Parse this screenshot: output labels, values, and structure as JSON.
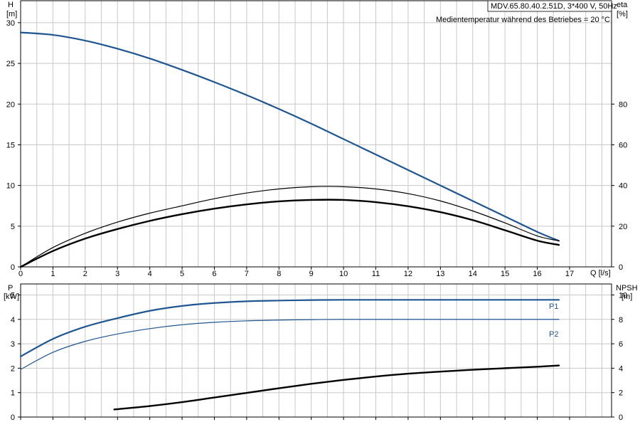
{
  "header": {
    "model": "MDV.65.80.40.2.51D, 3*400 V, 50Hz",
    "note": "Medientemperatur während des Betriebes = 20 °C"
  },
  "colors": {
    "blue": "#1f5590",
    "black": "#000000",
    "grid": "#c8c8c8"
  },
  "chart_data": [
    {
      "type": "line",
      "panel": "performance",
      "xlabel": "Q [l/s]",
      "x_ticks": [
        "0",
        "1",
        "2",
        "3",
        "4",
        "5",
        "6",
        "7",
        "8",
        "9",
        "10",
        "11",
        "12",
        "13",
        "14",
        "15",
        "16",
        "17"
      ],
      "xlim": [
        0,
        18.3
      ],
      "ylabel_left": "H",
      "ylabel_left_unit": "[m]",
      "ylim_left": [
        0,
        32.7
      ],
      "y_ticks_left": [
        "0",
        "5",
        "10",
        "15",
        "20",
        "25",
        "30"
      ],
      "ylabel_right": "eta",
      "ylabel_right_unit": "[%]",
      "ylim_right": [
        0,
        130.8
      ],
      "y_ticks_right": [
        "0",
        "20",
        "40",
        "60",
        "80"
      ],
      "grid": true,
      "series": [
        {
          "axis": "left",
          "color": "#1f5590",
          "width": 2.2,
          "x": [
            0,
            1,
            2,
            3,
            4,
            5,
            6,
            7,
            8,
            9,
            10,
            11,
            12,
            13,
            14,
            15,
            16,
            16.67
          ],
          "y": [
            28.8,
            28.5,
            27.8,
            26.8,
            25.6,
            24.2,
            22.7,
            21.1,
            19.4,
            17.6,
            15.7,
            13.8,
            11.9,
            10.0,
            8.1,
            6.2,
            4.3,
            3.2
          ]
        },
        {
          "axis": "right",
          "color": "#000000",
          "width": 1.2,
          "x": [
            0,
            1,
            2,
            3,
            4,
            5,
            6,
            7,
            8,
            9,
            10,
            11,
            12,
            13,
            14,
            15,
            16,
            16.67
          ],
          "y": [
            0,
            9.5,
            16.5,
            22.0,
            26.4,
            30.0,
            33.5,
            36.3,
            38.3,
            39.4,
            39.4,
            38.3,
            36.0,
            32.4,
            27.5,
            21.6,
            15.2,
            12.8
          ]
        },
        {
          "axis": "right",
          "color": "#000000",
          "width": 2.4,
          "x": [
            0,
            1,
            2,
            3,
            4,
            5,
            6,
            7,
            8,
            9,
            10,
            11,
            12,
            13,
            14,
            15,
            16,
            16.67
          ],
          "y": [
            0,
            7.8,
            13.9,
            18.6,
            22.6,
            25.9,
            28.6,
            30.7,
            32.2,
            32.9,
            32.9,
            31.8,
            29.8,
            26.9,
            23.0,
            18.0,
            12.9,
            10.8
          ]
        }
      ]
    },
    {
      "type": "line",
      "panel": "power",
      "xlim": [
        0,
        18.3
      ],
      "ylabel_left": "P",
      "ylabel_left_unit": "[kW]",
      "ylim_left": [
        0,
        5.45
      ],
      "y_ticks_left": [
        "0",
        "1",
        "2",
        "3",
        "4",
        "5"
      ],
      "ylabel_right": "NPSH",
      "ylabel_right_unit": "[m]",
      "ylim_right": [
        0,
        10.9
      ],
      "y_ticks_right": [
        "0",
        "2",
        "4",
        "6",
        "8",
        "10"
      ],
      "grid": true,
      "series": [
        {
          "name": "P1",
          "axis": "left",
          "color": "#1f5590",
          "width": 2.2,
          "x": [
            0,
            1,
            2,
            3,
            4,
            5,
            6,
            7,
            8,
            9,
            10,
            12,
            14,
            16,
            16.67
          ],
          "y": [
            2.48,
            3.2,
            3.7,
            4.05,
            4.35,
            4.55,
            4.67,
            4.74,
            4.77,
            4.79,
            4.8,
            4.8,
            4.8,
            4.8,
            4.8
          ]
        },
        {
          "name": "P2",
          "axis": "left",
          "color": "#1f5590",
          "width": 1.2,
          "x": [
            0,
            1,
            2,
            3,
            4,
            5,
            6,
            7,
            8,
            9,
            10,
            12,
            14,
            16,
            16.67
          ],
          "y": [
            1.95,
            2.65,
            3.1,
            3.4,
            3.62,
            3.78,
            3.88,
            3.94,
            3.97,
            3.99,
            4.0,
            4.0,
            4.0,
            4.0,
            4.0
          ]
        },
        {
          "axis": "right",
          "color": "#000000",
          "width": 2.4,
          "x": [
            2.9,
            4,
            5,
            6,
            7,
            8,
            9,
            10,
            11,
            12,
            13,
            14,
            15,
            16,
            16.67
          ],
          "y": [
            0.62,
            0.9,
            1.22,
            1.6,
            1.98,
            2.36,
            2.72,
            3.04,
            3.32,
            3.55,
            3.72,
            3.87,
            4.0,
            4.12,
            4.22
          ]
        }
      ]
    }
  ]
}
